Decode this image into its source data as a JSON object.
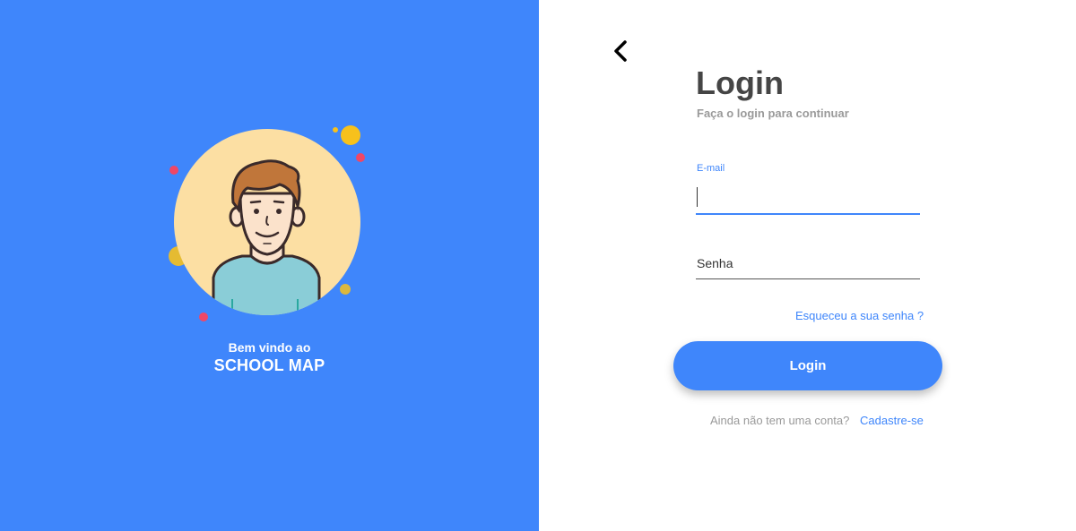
{
  "welcome": {
    "line1": "Bem vindo ao",
    "line2": "SCHOOL MAP"
  },
  "nav": {
    "back_icon": "chevron-left-icon"
  },
  "login": {
    "title": "Login",
    "subtitle": "Faça o login para continuar",
    "email_label": "E-mail",
    "email_value": "",
    "password_placeholder": "Senha",
    "forgot_link": "Esqueceu a sua senha ?",
    "button_label": "Login",
    "signup_prompt": "Ainda não tem uma conta?",
    "signup_link": "Cadastre-se"
  },
  "colors": {
    "primary": "#3F86FB",
    "title": "#454545",
    "muted": "#9a9a9a",
    "avatar_bg": "#FCDFA3",
    "dot_yellow": "#F7C11C",
    "dot_red": "#EF4766"
  }
}
